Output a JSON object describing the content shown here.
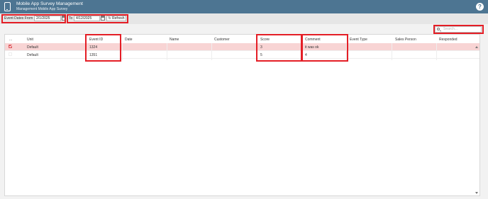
{
  "header": {
    "title": "Mobile App Survey Management",
    "subtitle": "Management Mobile App Survey",
    "help_label": "?"
  },
  "toolbar": {
    "from_label": "Event Dates From",
    "from_value": "2/1/2025",
    "to_label": "To",
    "to_value": "4/12/2025",
    "refresh_label": "Refresh"
  },
  "search": {
    "placeholder": "Search..."
  },
  "table": {
    "columns": [
      "...",
      "Unit",
      "Event ID",
      "Date",
      "Name",
      "Customer",
      "Score",
      "Comment",
      "Event Type",
      "Sales Person",
      "Responded"
    ],
    "rows": [
      {
        "unit": "Default",
        "event_id": "1324",
        "date": "",
        "name": "",
        "customer": "",
        "score": "3",
        "comment": "it was ok",
        "event_type": "",
        "sales_person": "",
        "responded": "",
        "selected": true
      },
      {
        "unit": "Default",
        "event_id": "1351",
        "date": "",
        "name": "",
        "customer": "",
        "score": "5",
        "comment": "4",
        "event_type": "",
        "sales_person": "",
        "responded": "",
        "selected": false
      }
    ]
  },
  "icons": [
    "mobile-phone-icon",
    "help-icon",
    "calendar-icon",
    "refresh-icon",
    "search-icon",
    "checkbox-icon",
    "scroll-up-icon",
    "scroll-down-icon"
  ],
  "colors": {
    "header": "#4d7592",
    "selected_row": "#f8d4d4",
    "highlight": "#e41e26"
  }
}
